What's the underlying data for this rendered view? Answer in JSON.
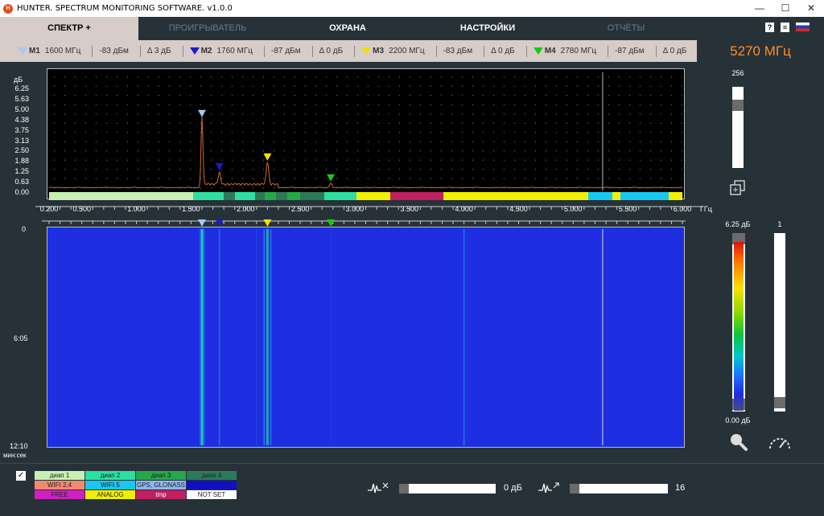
{
  "titlebar": {
    "title": "HUNTER. SPECTRUM MONITORING SOFTWARE. v1.0.0",
    "app_icon": "H"
  },
  "tabs": [
    {
      "label": "СПЕКТР +",
      "state": "active"
    },
    {
      "label": "ПРОИГРЫВАТЕЛЬ",
      "state": "disabled"
    },
    {
      "label": "ОХРАНА",
      "state": "normal"
    },
    {
      "label": "НАСТРОЙКИ",
      "state": "normal"
    },
    {
      "label": "ОТЧЁТЫ",
      "state": "disabled"
    }
  ],
  "tab_icons": {
    "help": "?",
    "doc": "≡",
    "language": "RU"
  },
  "markers": [
    {
      "name": "M1",
      "freq": "1600 МГц",
      "level": "-83 дБм",
      "delta": "Δ 3 дБ",
      "color": "#a8c8f0"
    },
    {
      "name": "M2",
      "freq": "1760 МГц",
      "level": "-87 дБм",
      "delta": "Δ 0 дБ",
      "color": "#1a1ad0"
    },
    {
      "name": "M3",
      "freq": "2200 МГц",
      "level": "-83 дБм",
      "delta": "Δ 0 дБ",
      "color": "#f0e000"
    },
    {
      "name": "M4",
      "freq": "2780 МГц",
      "level": "-87 дБм",
      "delta": "Δ 0 дБ",
      "color": "#18c818"
    }
  ],
  "center_freq": "5270 МГц",
  "spectrum": {
    "y_unit": "дБ",
    "y_ticks": [
      "6.25",
      "5.63",
      "5.00",
      "4.38",
      "3.75",
      "3.13",
      "2.50",
      "1.88",
      "1.25",
      "0.63",
      "0.00"
    ],
    "x_unit": "ГГц",
    "x_ticks": [
      "0.200",
      "0.500",
      "1.000",
      "1.500",
      "2.000",
      "2.500",
      "3.000",
      "3.500",
      "4.000",
      "4.500",
      "5.000",
      "5.500",
      "6.000"
    ],
    "x_min": 0.2,
    "x_max": 6.0,
    "cursor_ghz": 5.27,
    "peaks": [
      {
        "ghz": 1.6,
        "db": 3.75
      },
      {
        "ghz": 1.76,
        "db": 0.63
      },
      {
        "ghz": 2.2,
        "db": 1.25
      },
      {
        "ghz": 2.78,
        "db": 0.25
      }
    ],
    "marker_ghz": [
      1.6,
      1.76,
      2.2,
      2.78
    ]
  },
  "waterfall": {
    "time_labels": [
      "0",
      "6:05",
      "12:10"
    ],
    "time_unit": "мин:сек"
  },
  "right_panel": {
    "top_value": "256",
    "colorbar_max": "6.25 дБ",
    "colorbar_min": "0.00 дБ",
    "right_value": "1",
    "gain_level": 0.82,
    "right_level": 0.98
  },
  "legend": [
    {
      "label": "диап 1",
      "bg": "#c5f0b4"
    },
    {
      "label": "диап 2",
      "bg": "#2de0a0"
    },
    {
      "label": "диап 3",
      "bg": "#25a84a"
    },
    {
      "label": "диап 4",
      "bg": "#2b7a55"
    },
    {
      "label": "WIFI 2.4",
      "bg": "#f08a6e"
    },
    {
      "label": "WIFI 5",
      "bg": "#19c8f0"
    },
    {
      "label": "GPS, GLONASS",
      "bg": "#8ab8f0"
    },
    {
      "label": "",
      "bg": "#1010c0"
    },
    {
      "label": "FREE",
      "bg": "#d020c0"
    },
    {
      "label": "ANALOG",
      "bg": "#f0f000"
    },
    {
      "label": "tmp",
      "bg": "#c02060"
    },
    {
      "label": "NOT SET",
      "bg": "#ffffff"
    }
  ],
  "bottom": {
    "checkbox": "✓",
    "slider1_value": "0 дБ",
    "slider2_value": "16",
    "slider1_level": 0.0,
    "slider2_level": 0.0
  }
}
